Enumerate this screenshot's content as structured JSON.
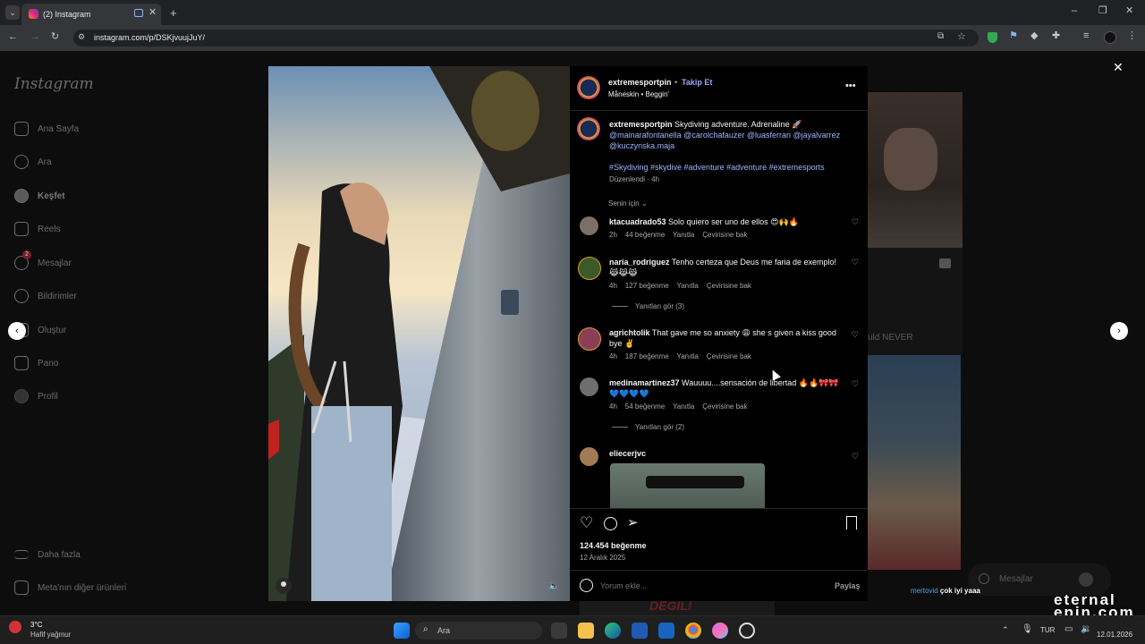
{
  "browser": {
    "tab_title": "(2) Instagram",
    "url": "instagram.com/p/DSKjvuujJuY/"
  },
  "sidebar": {
    "logo": "Instagram",
    "items": [
      {
        "label": "Ana Sayfa",
        "icon": "home-icon"
      },
      {
        "label": "Ara",
        "icon": "search-icon"
      },
      {
        "label": "Keşfet",
        "icon": "compass-icon"
      },
      {
        "label": "Reels",
        "icon": "reels-icon"
      },
      {
        "label": "Mesajlar",
        "icon": "messenger-icon",
        "badge": "2"
      },
      {
        "label": "Bildirimler",
        "icon": "heart-icon"
      },
      {
        "label": "Oluştur",
        "icon": "plus-icon"
      },
      {
        "label": "Pano",
        "icon": "chart-icon"
      },
      {
        "label": "Profil",
        "icon": "avatar-icon"
      }
    ],
    "more": "Daha fazla",
    "meta": "Meta'nın diğer ürünleri"
  },
  "post": {
    "author": "extremesportpin",
    "follow": "Takip Et",
    "music": "Måneskin • Beggin'",
    "caption_text": "Skydiving adventure. Adrenaline 🚀",
    "mentions": "@mainarafontanella @carolchafauzer @luasferrari @jayalvarrez @kuczynska.maja",
    "hashtags": "#Skydiving #skydive #adventure #adventure #extremesports",
    "edited": "Düzenlendi · 4h",
    "filter": "Senin için",
    "likes": "124.454 beğenme",
    "date": "12 Aralık 2025",
    "comment_placeholder": "Yorum ekle...",
    "share": "Paylaş"
  },
  "comments": [
    {
      "user": "ktacuadrado53",
      "text": "Solo quiero ser uno de ellos 😍🙌🔥",
      "time": "2h",
      "likes": "44 beğenme",
      "reply": "Yanıtla",
      "translate": "Çevirisine bak",
      "color": "#7d6e68"
    },
    {
      "user": "naria_rodriguez",
      "text": "Tenho certeza que Deus me faria de exemplo! 😹😹😹",
      "time": "4h",
      "likes": "127 beğenme",
      "reply": "Yanıtla",
      "translate": "Çevirisine bak",
      "replies": "Yanıtları gör (3)",
      "color": "#3b5a2a"
    },
    {
      "user": "agrichtolik",
      "text": "That gave me so anxiety 😩 she s given a kiss good bye ✌️",
      "time": "4h",
      "likes": "187 beğenme",
      "reply": "Yanıtla",
      "translate": "Çevirisine bak",
      "color": "#8a3f56"
    },
    {
      "user": "medinamartinez37",
      "text": "Wauuuu....sensación de libertad 🔥🔥🎀🎀💙💙💙💙",
      "time": "4h",
      "likes": "54 beğenme",
      "reply": "Yanıtla",
      "translate": "Çevirisine bak",
      "replies": "Yanıtları gör (2)",
      "color": "#6e6e6e"
    },
    {
      "user": "eliecerjvc",
      "color": "#a07b55"
    }
  ],
  "background_text": "uld NEVER",
  "bg_ad_text": "DEĞİL!",
  "messages_popup": "Mesajlar",
  "stream_overlay": {
    "user": "mertovid",
    "text": "çok iyi yaaa"
  },
  "watermark": "eternal epin.com",
  "taskbar": {
    "weather_temp": "3°C",
    "weather_desc": "Hafif yağmur",
    "search": "Ara",
    "lang": "TUR",
    "date": "12.01.2026"
  }
}
